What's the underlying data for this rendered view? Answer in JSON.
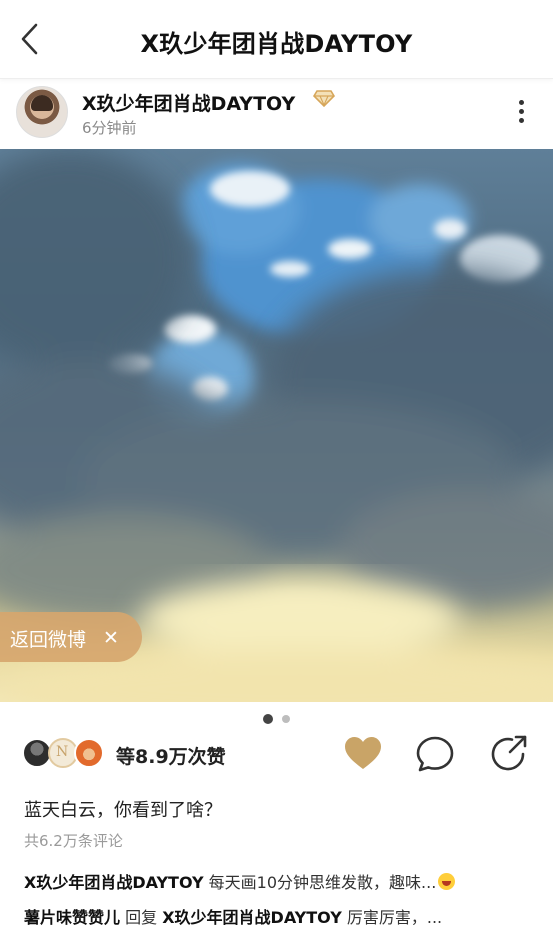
{
  "header": {
    "title": "X玖少年团肖战DAYTOY",
    "back_icon": "chevron-left-icon"
  },
  "author": {
    "name": "X玖少年团肖战DAYTOY",
    "time": "6分钟前",
    "badge_icon": "gold-diamond-icon",
    "badge_color": "#d6a65a"
  },
  "media": {
    "description_icon": "sky-photo",
    "page_count": 2,
    "current_page": 1,
    "return_label": "返回微博",
    "return_close": "✕",
    "return_color": "#d6a66e"
  },
  "engagement": {
    "likes_text": "等8.9万次赞",
    "liked": true,
    "like_color": "#c9a467"
  },
  "post": {
    "caption": "蓝天白云，你看到了啥？",
    "comments_total": "共6.2万条评论"
  },
  "comments": [
    {
      "author": "X玖少年团肖战DAYTOY",
      "text": " 每天画10分钟思维发散，趣味..."
    },
    {
      "author": "薯片味赞赞儿",
      "reply_word": " 回复 ",
      "reply_to": "X玖少年团肖战DAYTOY",
      "text": " 厉害厉害，..."
    }
  ]
}
